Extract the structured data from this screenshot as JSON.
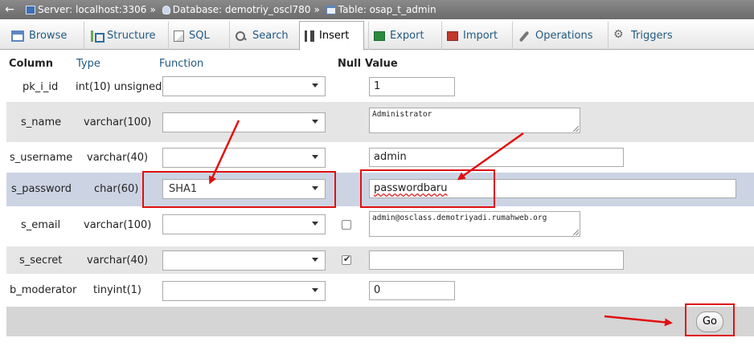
{
  "breadcrumb": {
    "back": "←",
    "server": "Server: localhost:3306",
    "database": "Database: demotriy_oscl780",
    "table": "Table: osap_t_admin",
    "separator": "»"
  },
  "tabs": [
    {
      "label": "Browse",
      "icon": "browse-icon"
    },
    {
      "label": "Structure",
      "icon": "structure-icon"
    },
    {
      "label": "SQL",
      "icon": "sql-icon"
    },
    {
      "label": "Search",
      "icon": "search-icon"
    },
    {
      "label": "Insert",
      "icon": "insert-icon",
      "active": true
    },
    {
      "label": "Export",
      "icon": "export-icon"
    },
    {
      "label": "Import",
      "icon": "import-icon"
    },
    {
      "label": "Operations",
      "icon": "operations-icon"
    },
    {
      "label": "Triggers",
      "icon": "triggers-icon"
    }
  ],
  "headers": {
    "column": "Column",
    "type": "Type",
    "function": "Function",
    "null": "Null",
    "value": "Value"
  },
  "rows": [
    {
      "column": "pk_i_id",
      "type": "int(10) unsigned",
      "function": "",
      "null_checkbox": false,
      "null_checked": false,
      "value": "1"
    },
    {
      "column": "s_name",
      "type": "varchar(100)",
      "function": "",
      "null_checkbox": false,
      "null_checked": false,
      "value": "Administrator"
    },
    {
      "column": "s_username",
      "type": "varchar(40)",
      "function": "",
      "null_checkbox": false,
      "null_checked": false,
      "value": "admin"
    },
    {
      "column": "s_password",
      "type": "char(60)",
      "function": "SHA1",
      "null_checkbox": false,
      "null_checked": false,
      "value": "passwordbaru"
    },
    {
      "column": "s_email",
      "type": "varchar(100)",
      "function": "",
      "null_checkbox": true,
      "null_checked": false,
      "value": "admin@osclass.demotriyadi.rumahweb.org"
    },
    {
      "column": "s_secret",
      "type": "varchar(40)",
      "function": "",
      "null_checkbox": true,
      "null_checked": true,
      "value": ""
    },
    {
      "column": "b_moderator",
      "type": "tinyint(1)",
      "function": "",
      "null_checkbox": false,
      "null_checked": false,
      "value": "0"
    }
  ],
  "go_button": "Go",
  "colors": {
    "annotation_red": "#e01010",
    "highlight_row": "#ccd4e4",
    "link_blue": "#235a81"
  }
}
